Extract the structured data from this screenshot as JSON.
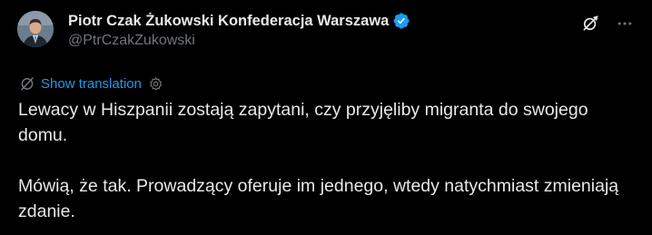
{
  "author": {
    "display_name": "Piotr Czak Żukowski Konfederacja Warszawa",
    "handle": "@PtrCzakZukowski",
    "verified_color": "#1d9bf0",
    "avatar_icon": "avatar-photo"
  },
  "actions": {
    "grok_icon": "grok-icon",
    "more_icon": "more-icon"
  },
  "translation": {
    "link_label": "Show translation",
    "icon": "translate-icon",
    "settings_icon": "gear-icon",
    "link_color": "#1d9bf0"
  },
  "post": {
    "paragraphs": [
      "Lewacy w Hiszpanii zostają zapytani, czy przyjęliby migranta do swojego domu.",
      "Mówią, że tak. Prowadzący oferuje im jednego, wtedy natychmiast zmieniają zdanie."
    ]
  },
  "theme": {
    "background": "#000000",
    "text": "#e7e9ea",
    "secondary_text": "#71767b"
  }
}
